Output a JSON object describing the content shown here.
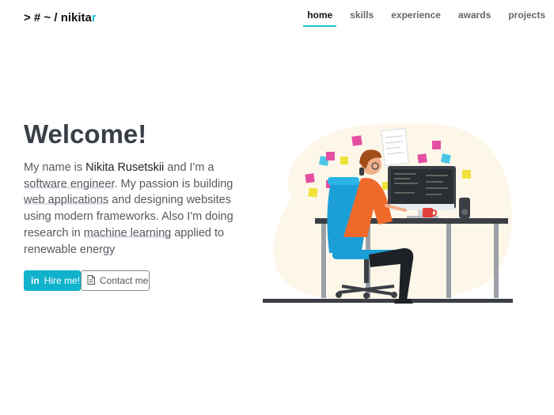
{
  "brand": {
    "prefix": "> # ~ / nikita",
    "accent": "r"
  },
  "nav": [
    {
      "label": "home",
      "active": true
    },
    {
      "label": "skills",
      "active": false
    },
    {
      "label": "experience",
      "active": false
    },
    {
      "label": "awards",
      "active": false
    },
    {
      "label": "projects",
      "active": false
    }
  ],
  "hero": {
    "title": "Welcome!",
    "bio": {
      "p1": "My name is ",
      "name": "Nikita Rusetskii",
      "p2": " and I'm a ",
      "role": "software engineer",
      "p3": ". My passion is building ",
      "hl1": "web applications",
      "p4": " and designing websites using modern frameworks. Also I'm doing research in ",
      "hl2": "machine learning",
      "p5": " applied to renewable energy"
    },
    "hire_label": "Hire me!",
    "contact_label": "Contact me"
  },
  "colors": {
    "accent": "#1ec5d6",
    "button": "#11b3cc"
  }
}
